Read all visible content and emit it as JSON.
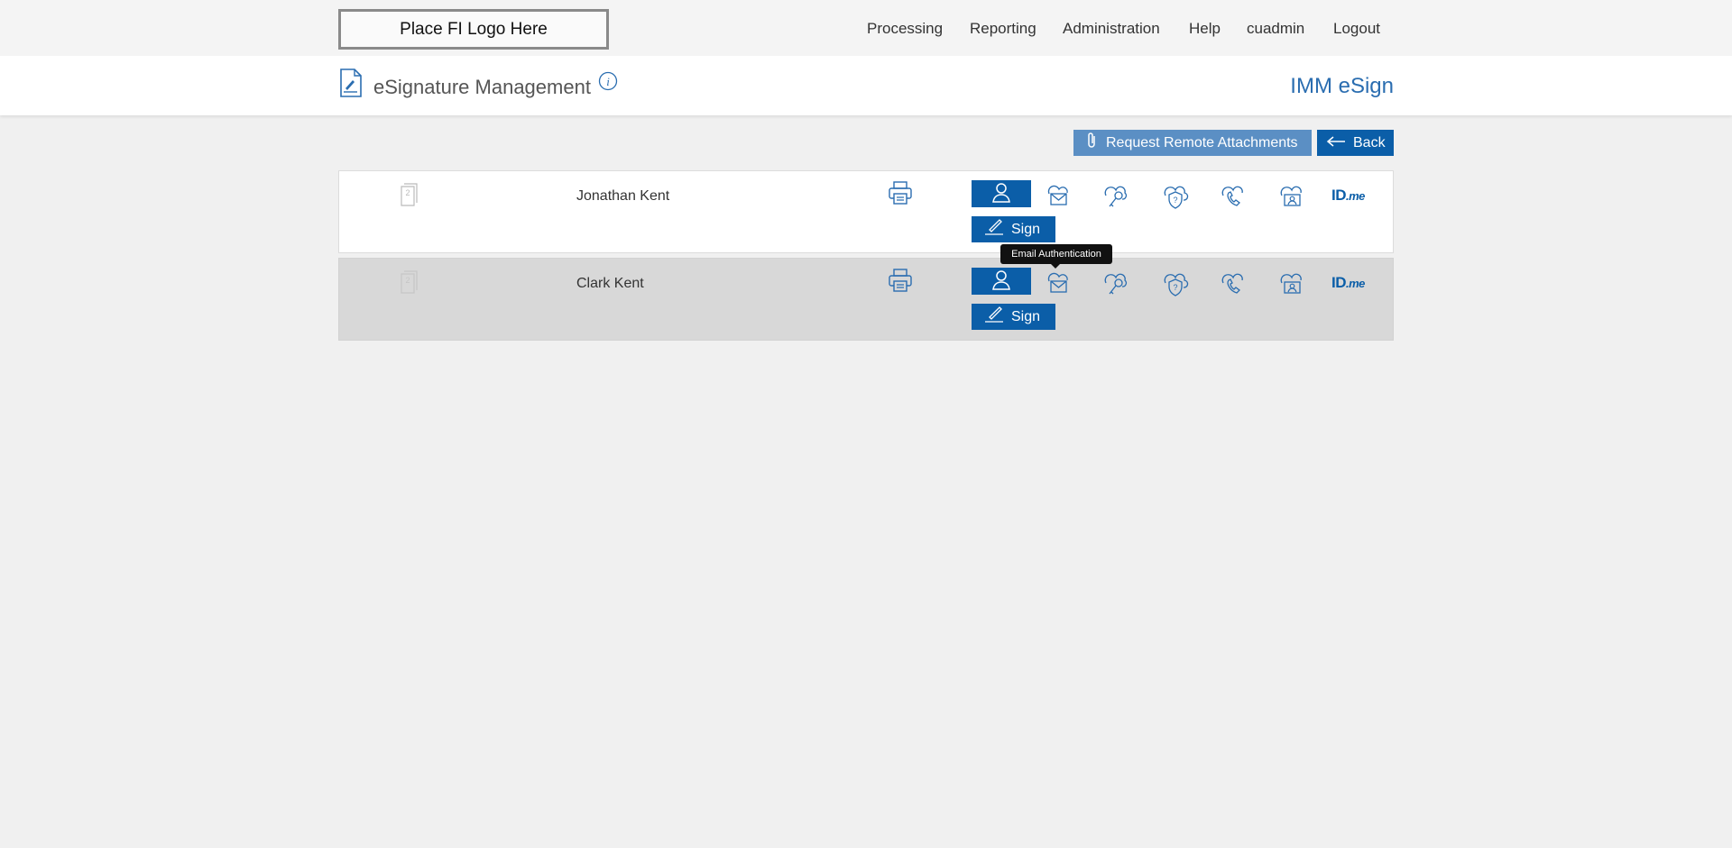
{
  "header": {
    "logo_text": "Place FI Logo Here",
    "nav": [
      "Processing",
      "Reporting",
      "Administration",
      "Help",
      "cuadmin",
      "Logout"
    ]
  },
  "titlebar": {
    "title": "eSignature Management",
    "brand": "IMM eSign"
  },
  "actions": {
    "request_label": "Request Remote Attachments",
    "back_label": "Back"
  },
  "signers": [
    {
      "doc_count": "2",
      "name": "Jonathan Kent",
      "sign_label": "Sign"
    },
    {
      "doc_count": "2",
      "name": "Clark Kent",
      "sign_label": "Sign"
    }
  ],
  "auth_methods": [
    "person-icon",
    "email-cloud-icon",
    "key-cloud-icon",
    "question-shield-icon",
    "phone-cloud-icon",
    "id-card-cloud-icon",
    "idme-logo"
  ],
  "idme": {
    "id": "ID",
    "me": ".me"
  },
  "tooltip": "Email Authentication",
  "colors": {
    "accent": "#0b5ea8",
    "accent_light": "#5b8fc4",
    "brand": "#2a6db0"
  }
}
